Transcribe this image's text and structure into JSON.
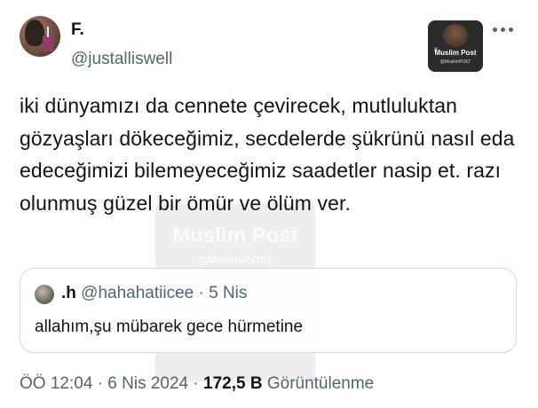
{
  "author": {
    "display_name": "F.",
    "handle": "@justalliswell"
  },
  "watermark": {
    "brand": "Muslim Post",
    "handle": "@MuslimPOST"
  },
  "tweet": {
    "text": "iki dünyamızı da cennete çevirecek, mutluluktan gözyaşları dökeceğimiz, secdelerde şükrünü nasıl eda edeceğimizi bilemeyeceğimiz saadetler nasip et. razı olunmuş güzel bir ömür ve ölüm ver."
  },
  "quote": {
    "display_name": ".h",
    "handle": "@hahahatiicee",
    "separator": "·",
    "date": "5 Nis",
    "text": "allahım,şu mübarek gece hürmetine"
  },
  "meta": {
    "time": "ÖÖ 12:04",
    "separator": "·",
    "date": "6 Nis 2024",
    "views_count": "172,5 B",
    "views_label": "Görüntülenme"
  },
  "icons": {
    "more": "more-horizontal-icon"
  }
}
